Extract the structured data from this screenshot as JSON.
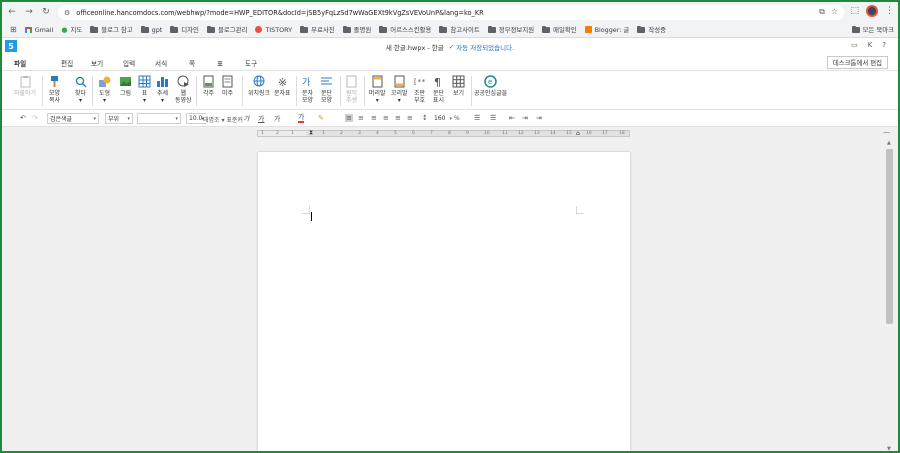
{
  "browser": {
    "url": "officeonline.hancomdocs.com/webhwp/?mode=HWP_EDITOR&docId=jSB5yFqLzSd7wWaGEXt9kVgZsVEVoUnP&lang=ko_KR",
    "bookmarks": [
      "Gmail",
      "지도",
      "블로그 참고",
      "gpt",
      "디자인",
      "블로그관리",
      "TISTORY",
      "무료사진",
      "졸명원",
      "어르스스킨활용",
      "참고사이트",
      "정부정보지원",
      "매일확인",
      "Blogger: 글",
      "작성중"
    ],
    "all_bookmarks": "모든 북마크"
  },
  "app": {
    "logo": "5",
    "doc_title": "새 한글.hwpx - 한글",
    "save_status": "자동 저장되었습니다.",
    "account_initial": "K"
  },
  "menu": {
    "tabs": [
      "파일",
      "편집",
      "보기",
      "입력",
      "서식",
      "쪽",
      "표",
      "도구"
    ],
    "desktop_button": "데스크톱에서 편집"
  },
  "ribbon": {
    "items": [
      {
        "l1": "하할하기",
        "l2": "",
        "disabled": true
      },
      {
        "l1": "모양",
        "l2": "복사"
      },
      {
        "l1": "찾다",
        "l2": "▾"
      },
      {
        "l1": "도형",
        "l2": "▾"
      },
      {
        "l1": "그림",
        "l2": ""
      },
      {
        "l1": "표",
        "l2": "▾"
      },
      {
        "l1": "추세",
        "l2": "▾"
      },
      {
        "l1": "웹",
        "l2": "동영상"
      },
      {
        "l1": "각주",
        "l2": ""
      },
      {
        "l1": "미주",
        "l2": ""
      },
      {
        "l1": "위치링크",
        "l2": ""
      },
      {
        "l1": "문자표",
        "l2": ""
      },
      {
        "l1": "문자",
        "l2": "모양"
      },
      {
        "l1": "문단",
        "l2": "모양"
      },
      {
        "l1": "원익",
        "l2": "추생",
        "disabled": true
      },
      {
        "l1": "머리말",
        "l2": "▾"
      },
      {
        "l1": "꼬리말",
        "l2": "▾"
      },
      {
        "l1": "조판",
        "l2": "부호"
      },
      {
        "l1": "문단",
        "l2": "표시"
      },
      {
        "l1": "보기",
        "l2": ""
      },
      {
        "l1": "공공안심글꼴",
        "l2": ""
      }
    ]
  },
  "format": {
    "style": "검은색글",
    "face": "부위",
    "font": "",
    "size": "10.0",
    "weight_label": "태명조 ▾ 표준커",
    "line_spacing": "160",
    "percent": "%"
  },
  "ruler": {
    "ticks": [
      "1",
      "2",
      "1",
      "1",
      "2",
      "3",
      "4",
      "5",
      "6",
      "7",
      "8",
      "9",
      "10",
      "11",
      "12",
      "13",
      "14",
      "15",
      "16",
      "17",
      "18"
    ]
  }
}
